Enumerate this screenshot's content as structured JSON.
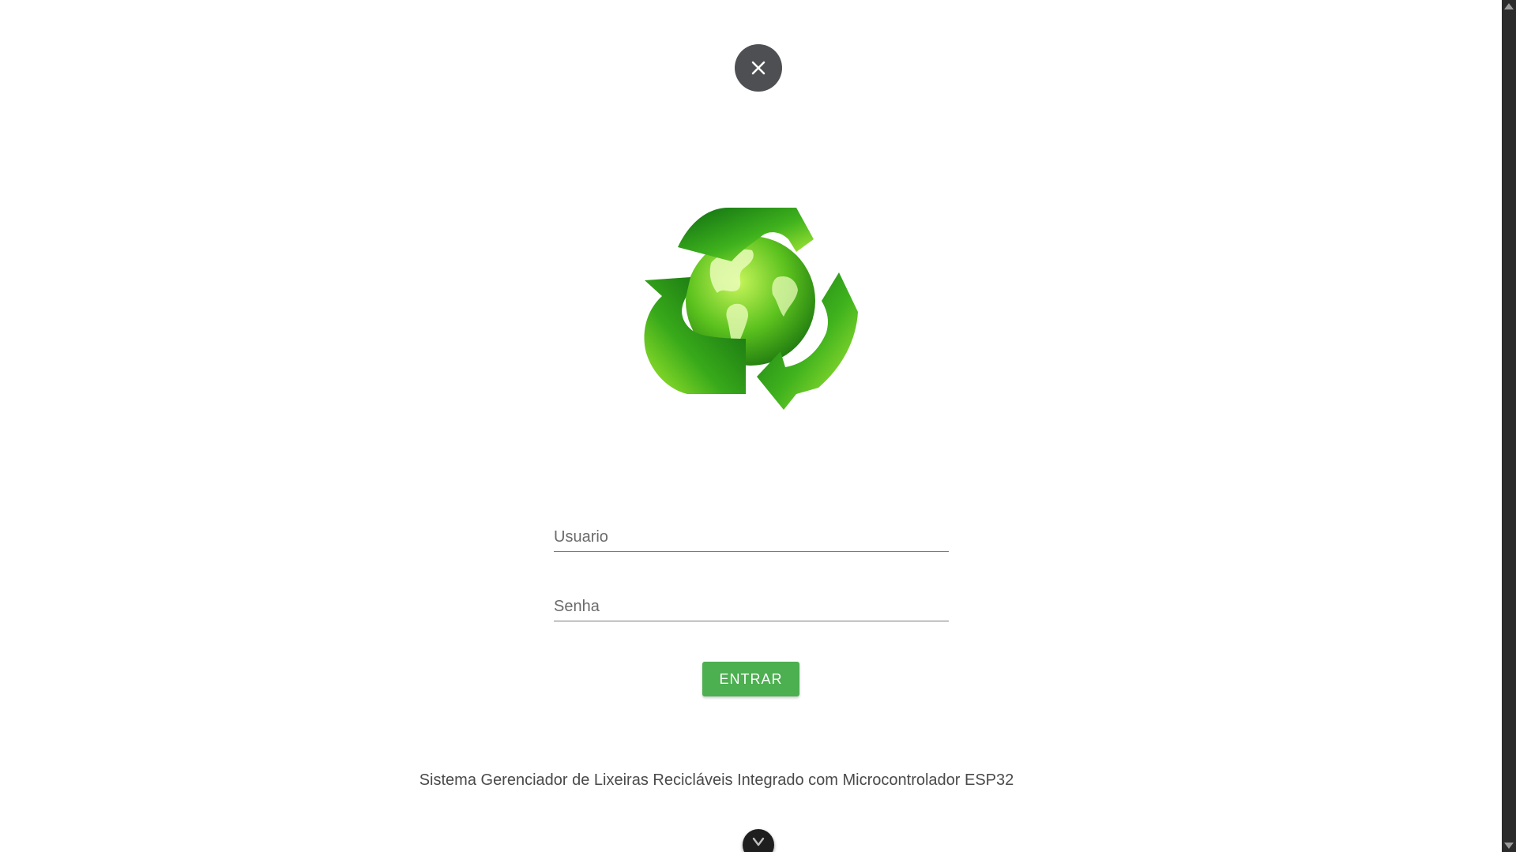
{
  "close_button": {
    "icon": "close-icon"
  },
  "logo": {
    "icon": "recycle-globe-icon"
  },
  "login_form": {
    "username_placeholder": "Usuario",
    "password_placeholder": "Senha",
    "submit_label": "ENTRAR"
  },
  "footer": {
    "text": "Sistema Gerenciador de Lixeiras Recicláveis Integrado com Microcontrolador ESP32"
  },
  "scroll_down_button": {
    "icon": "chevron-down-icon"
  },
  "colors": {
    "accent": "#4caf50",
    "close_bg": "#4d4f53",
    "text": "#4a4a4a"
  }
}
